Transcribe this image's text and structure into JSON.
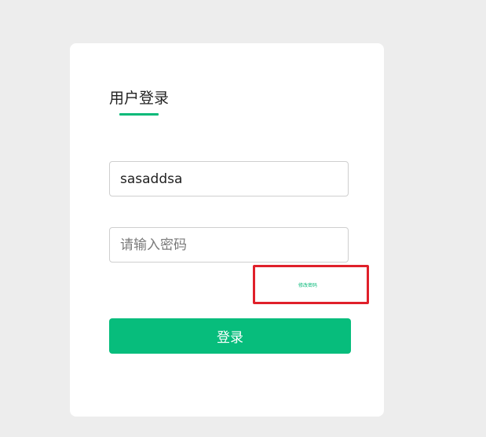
{
  "login_card": {
    "title": "用户登录",
    "username_value": "sasaddsa",
    "password_placeholder": "请输入密码",
    "change_password_label": "修改密码",
    "login_button_label": "登录"
  },
  "colors": {
    "background": "#ededed",
    "accent": "#07bd7c",
    "highlight_box": "#e0202a"
  }
}
